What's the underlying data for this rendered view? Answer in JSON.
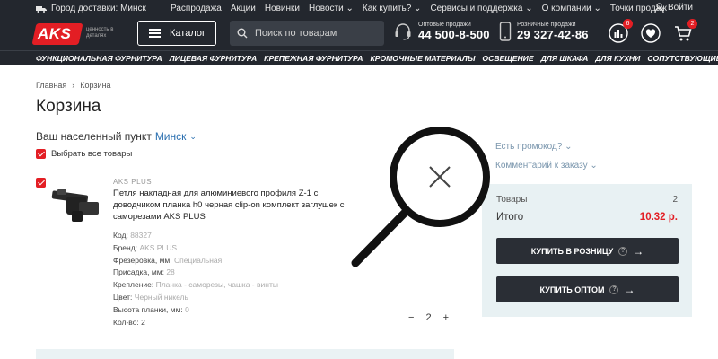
{
  "topbar": {
    "delivery_city": "Город доставки: Минск",
    "nav": [
      "Распродажа",
      "Акции",
      "Новинки",
      "Новости",
      "Как купить?",
      "Сервисы и поддержка",
      "О компании",
      "Точки продаж"
    ],
    "login": "Войти"
  },
  "header": {
    "logo": "AKS",
    "slogan": "ценность в деталях",
    "catalog": "Каталог",
    "search_placeholder": "Поиск по товарам",
    "wholesale_label": "Оптовые продажи",
    "wholesale_phone": "44 500-8-500",
    "retail_label": "Розничные продажи",
    "retail_phone": "29 327-42-86",
    "compare_count": "6",
    "cart_count": "2"
  },
  "categories": [
    "ФУНКЦИОНАЛЬНАЯ ФУРНИТУРА",
    "ЛИЦЕВАЯ ФУРНИТУРА",
    "КРЕПЕЖНАЯ ФУРНИТУРА",
    "КРОМОЧНЫЕ МАТЕРИАЛЫ",
    "ОСВЕЩЕНИЕ",
    "ДЛЯ ШКАФА",
    "ДЛЯ КУХНИ",
    "СОПУТСТВУЮЩИЕ"
  ],
  "breadcrumb": {
    "home": "Главная",
    "current": "Корзина"
  },
  "page_title": "Корзина",
  "locality": {
    "label": "Ваш населенный пункт",
    "city": "Минск"
  },
  "select_all": "Выбрать все товары",
  "product": {
    "brand_tag": "AKS PLUS",
    "title": "Петля накладная для алюминиевого профиля Z-1 с доводчиком планка h0 черная clip-on комплект заглушек с саморезами AKS PLUS",
    "specs": [
      {
        "label": "Код:",
        "value": "88327"
      },
      {
        "label": "Бренд:",
        "value": "AKS PLUS"
      },
      {
        "label": "Фрезеровка, мм:",
        "value": "Специальная"
      },
      {
        "label": "Присадка, мм:",
        "value": "28"
      },
      {
        "label": "Крепление:",
        "value": "Планка - саморезы, чашка - винты"
      },
      {
        "label": "Цвет:",
        "value": "Черный никель"
      },
      {
        "label": "Высота планки, мм:",
        "value": "0"
      },
      {
        "label": "Кол-во:",
        "value": "2"
      }
    ],
    "qty": "2",
    "qty_minus": "−",
    "qty_plus": "+"
  },
  "order": {
    "promo": "Есть промокод?",
    "comment": "Комментарий к заказу",
    "items_label": "Товары",
    "items_count": "2",
    "total_label": "Итого",
    "total_value": "10.32 р.",
    "retail_button": "КУПИТЬ В РОЗНИЦУ",
    "wholesale_button": "КУПИТЬ ОПТОМ"
  },
  "colors": {
    "brand": "#e31e24",
    "dark": "#23272e",
    "link": "#2a6fb0",
    "summary_bg": "#e8f1f3"
  }
}
